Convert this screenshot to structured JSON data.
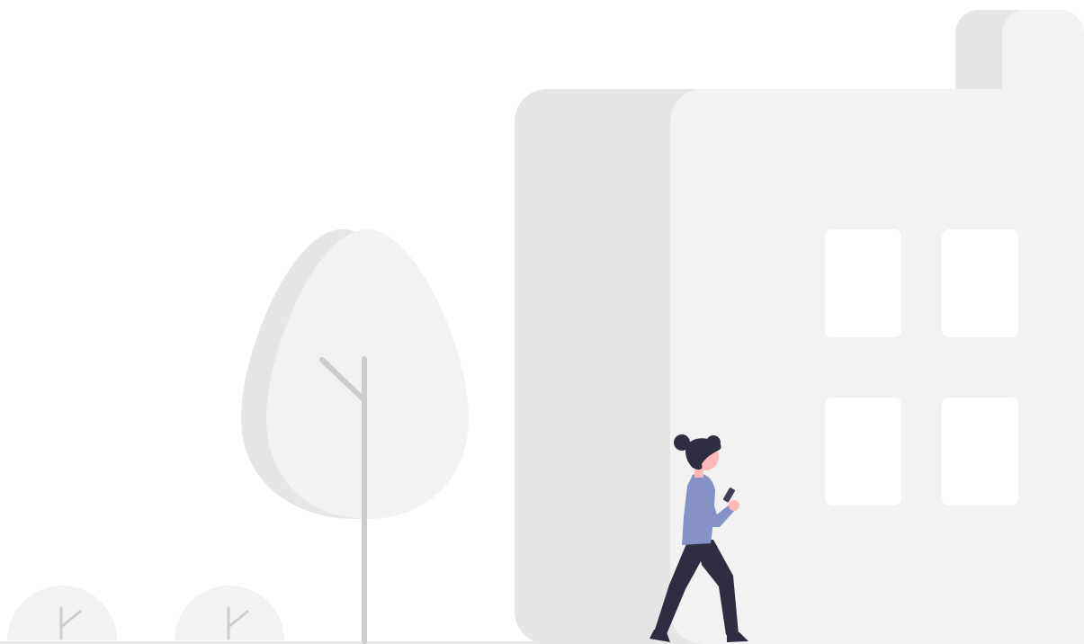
{
  "illustration": {
    "elements": [
      "building",
      "tree",
      "bush",
      "person",
      "phone"
    ]
  },
  "colors": {
    "background": "#ffffff",
    "shade_light": "#f2f2f2",
    "shade_dark": "#e6e6e6",
    "trunk": "#cccccc",
    "window": "#ffffff",
    "hair": "#2f2e41",
    "skin": "#ffb8b8",
    "shirt": "#8591c7",
    "pants": "#2f2e41",
    "phone": "#3f3d56"
  }
}
